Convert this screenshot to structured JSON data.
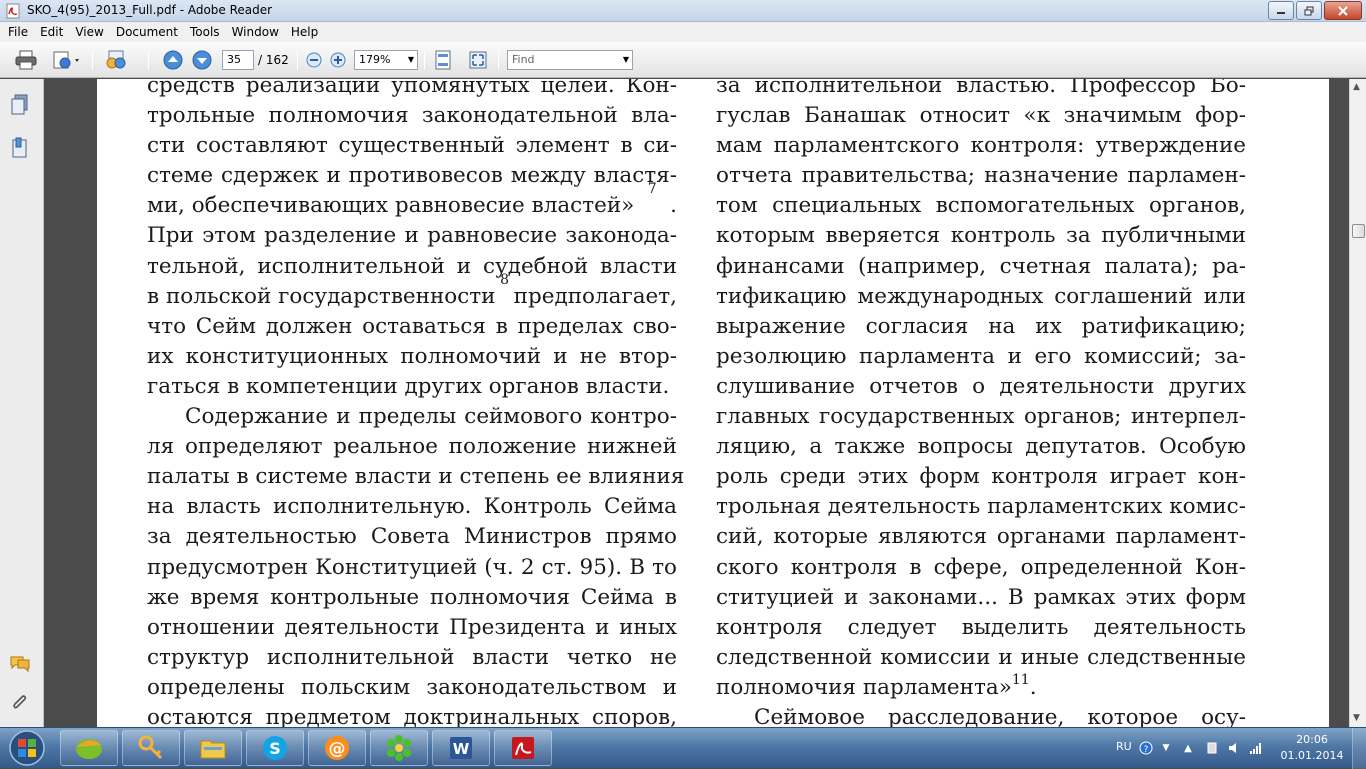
{
  "window": {
    "title": "SKO_4(95)_2013_Full.pdf - Adobe Reader",
    "icon": "pdf-file-icon"
  },
  "menu": [
    "File",
    "Edit",
    "View",
    "Document",
    "Tools",
    "Window",
    "Help"
  ],
  "toolbar": {
    "current_page": "35",
    "page_total": "/ 162",
    "zoom": "179%",
    "find_placeholder": "Find"
  },
  "document": {
    "left_column": [
      {
        "t": "средств реализации упомянутых целей. Кон-",
        "j": true
      },
      {
        "t": "трольные полномочия законодательной вла-",
        "j": true
      },
      {
        "t": "сти составляют существенный элемент в си-",
        "j": true
      },
      {
        "t": "стеме сдержек и противовесов между властя-",
        "j": true
      },
      {
        "t": "ми, обеспечивающих равновесие властей»",
        "sup": "7",
        "tail": ".",
        "j": true
      },
      {
        "t": "При этом разделение и равновесие законода-",
        "j": true
      },
      {
        "t": "тельной, исполнительной и судебной власти",
        "j": true
      },
      {
        "t": "в польской государственности",
        "sup": "8",
        "tail": " предполагает,",
        "j": true
      },
      {
        "t": "что Сейм должен оставаться в пределах сво-",
        "j": true
      },
      {
        "t": "их конституционных полномочий и не втор-",
        "j": true
      },
      {
        "t": "гаться в компетенции других органов власти.",
        "j": false
      },
      {
        "t": "Содержание и пределы сеймового контро-",
        "j": true,
        "indent": true
      },
      {
        "t": "ля определяют реальное положение нижней",
        "j": true
      },
      {
        "t": "палаты в системе власти и степень ее влияния",
        "j": true
      },
      {
        "t": "на власть исполнительную. Контроль Сейма",
        "j": true
      },
      {
        "t": "за деятельностью Совета Министров прямо",
        "j": true
      },
      {
        "t": "предусмотрен Конституцией (ч. 2 ст. 95). В то",
        "j": true
      },
      {
        "t": "же время контрольные полномочия Сейма в",
        "j": true
      },
      {
        "t": "отношении деятельности Президента и иных",
        "j": true
      },
      {
        "t": "структур исполнительной власти четко не",
        "j": true
      },
      {
        "t": "определены польским законодательством и",
        "j": true
      },
      {
        "t": "остаются предметом доктринальных споров,",
        "j": true
      }
    ],
    "right_column": [
      {
        "t": "за исполнительной властью. Профессор Бо-",
        "j": true
      },
      {
        "t": "гуслав Банашак относит «к значимым фор-",
        "j": true
      },
      {
        "t": "мам парламентского контроля: утверждение",
        "j": true
      },
      {
        "t": "отчета правительства; назначение парламен-",
        "j": true
      },
      {
        "t": "том специальных вспомогательных органов,",
        "j": true
      },
      {
        "t": "которым вверяется контроль за публичными",
        "j": true
      },
      {
        "t": "финансами (например, счетная палата); ра-",
        "j": true
      },
      {
        "t": "тификацию международных соглашений или",
        "j": true
      },
      {
        "t": "выражение согласия на их ратификацию;",
        "j": true
      },
      {
        "t": "резолюцию парламента и его комиссий; за-",
        "j": true
      },
      {
        "t": "слушивание отчетов о деятельности других",
        "j": true
      },
      {
        "t": "главных государственных органов; интерпел-",
        "j": true
      },
      {
        "t": "ляцию, а также вопросы депутатов. Особую",
        "j": true
      },
      {
        "t": "роль среди этих форм контроля играет кон-",
        "j": true
      },
      {
        "t": "трольная деятельность парламентских комис-",
        "j": true
      },
      {
        "t": "сий, которые являются органами парламент-",
        "j": true
      },
      {
        "t": "ского контроля в сфере, определенной Кон-",
        "j": true
      },
      {
        "t": "ституцией и законами... В рамках этих форм",
        "j": true
      },
      {
        "t": "контроля следует выделить деятельность",
        "j": true
      },
      {
        "t": "следственной комиссии и иные следственные",
        "j": true
      },
      {
        "t": "полномочия парламента»",
        "sup": "11",
        "tail": ".",
        "j": false
      },
      {
        "t": "Сеймовое расследование, которое осу-",
        "j": true,
        "indent": true
      }
    ]
  },
  "taskbar": {
    "apps": [
      "greenshot-app-icon",
      "keys-app-icon",
      "file-explorer-icon",
      "skype-icon",
      "mail-at-icon",
      "icq-flower-icon",
      "word-icon",
      "adobe-reader-icon"
    ],
    "tray": {
      "language": "RU",
      "time": "20:06",
      "date": "01.01.2014"
    }
  },
  "colors": {
    "doc_background": "#4b4b4b",
    "taskbar": "#4f78a6",
    "pdf_red": "#c8161d"
  }
}
